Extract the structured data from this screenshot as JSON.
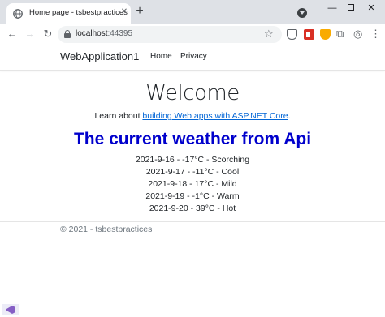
{
  "browser": {
    "tab_title": "Home page - tsbestpractices",
    "tab_close": "✕",
    "new_tab": "+",
    "url_host": "localhost",
    "url_port": ":44395",
    "window_min": "—",
    "window_close": "✕",
    "nav_back": "←",
    "nav_forward": "→",
    "nav_reload": "↻",
    "star": "☆",
    "puzzle": "⧉",
    "profile": "◎",
    "menu": "⋮"
  },
  "site": {
    "brand": "WebApplication1",
    "nav": {
      "home": "Home",
      "privacy": "Privacy"
    }
  },
  "main": {
    "heading": "Welcome",
    "learn_prefix": "Learn about ",
    "learn_link": "building Web apps with ASP.NET Core",
    "learn_suffix": ".",
    "weather_title": "The current weather from Api",
    "forecast": [
      "2021-9-16 - -17°C - Scorching",
      "2021-9-17 - -11°C - Cool",
      "2021-9-18 - 17°C - Mild",
      "2021-9-19 - -1°C - Warm",
      "2021-9-20 - 39°C - Hot"
    ]
  },
  "footer": {
    "text": "© 2021 - tsbestpractices"
  },
  "colors": {
    "link": "#0366d6",
    "weather_title": "#0000cc",
    "tabstrip": "#dee1e6"
  },
  "icons": [
    "globe-icon",
    "close-icon",
    "plus-icon",
    "tab-search-icon",
    "back-arrow-icon",
    "forward-arrow-icon",
    "reload-icon",
    "lock-icon",
    "star-icon",
    "pocket-icon",
    "extension-icon",
    "shield-icon",
    "puzzle-icon",
    "profile-icon",
    "menu-dots-icon",
    "visual-studio-icon"
  ]
}
